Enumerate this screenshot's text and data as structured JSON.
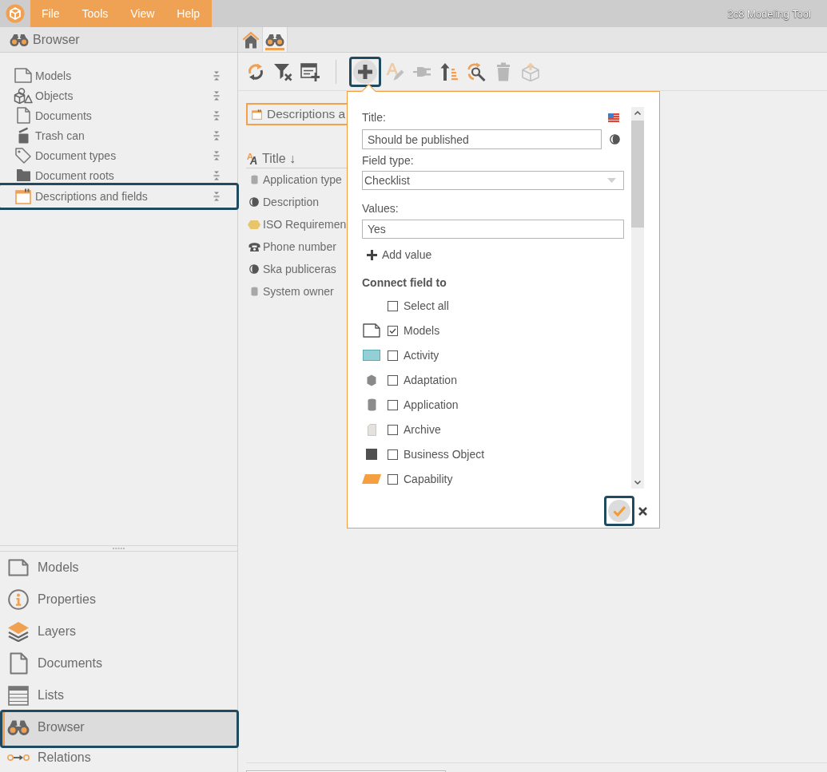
{
  "menu_bar": {
    "items": [
      {
        "label": "File"
      },
      {
        "label": "Tools"
      },
      {
        "label": "View"
      },
      {
        "label": "Help"
      }
    ],
    "app_title": "2c8 Modeling Tool"
  },
  "browser_panel": {
    "title": "Browser",
    "items": [
      {
        "label": "Models",
        "kind": "page",
        "highlighted": false
      },
      {
        "label": "Objects",
        "kind": "shapes",
        "highlighted": false
      },
      {
        "label": "Documents",
        "kind": "document",
        "highlighted": false
      },
      {
        "label": "Trash can",
        "kind": "trash",
        "highlighted": false
      },
      {
        "label": "Document types",
        "kind": "tag",
        "highlighted": false
      },
      {
        "label": "Document roots",
        "kind": "folder",
        "highlighted": false
      },
      {
        "label": "Descriptions and fields",
        "kind": "window",
        "highlighted": true
      }
    ]
  },
  "side_nav": {
    "items": [
      {
        "label": "Models",
        "kind": "page",
        "selected": false,
        "highlighted": false
      },
      {
        "label": "Properties",
        "kind": "info",
        "selected": false,
        "highlighted": false
      },
      {
        "label": "Layers",
        "kind": "layers",
        "selected": false,
        "highlighted": false
      },
      {
        "label": "Documents",
        "kind": "document",
        "selected": false,
        "highlighted": false
      },
      {
        "label": "Lists",
        "kind": "list",
        "selected": false,
        "highlighted": false
      },
      {
        "label": "Browser",
        "kind": "binoculars",
        "selected": true,
        "highlighted": true
      },
      {
        "label": "Relations",
        "kind": "relations",
        "selected": false,
        "highlighted": false
      }
    ]
  },
  "tabs": [
    {
      "kind": "home",
      "selected": false
    },
    {
      "kind": "binoculars",
      "selected": true
    }
  ],
  "toolbar": {
    "groups": [
      [
        {
          "kind": "refresh",
          "disabled": false,
          "highlighted": false
        },
        {
          "kind": "filter",
          "disabled": false,
          "highlighted": false
        },
        {
          "kind": "table",
          "disabled": false,
          "highlighted": false
        }
      ],
      [
        {
          "kind": "add",
          "disabled": false,
          "highlighted": true
        },
        {
          "kind": "font",
          "disabled": true,
          "highlighted": false
        },
        {
          "kind": "plug",
          "disabled": true,
          "highlighted": false
        },
        {
          "kind": "sort",
          "disabled": false,
          "highlighted": false
        },
        {
          "kind": "replace",
          "disabled": false,
          "highlighted": false
        },
        {
          "kind": "bin",
          "disabled": true,
          "highlighted": false
        },
        {
          "kind": "box",
          "disabled": true,
          "highlighted": false
        }
      ]
    ]
  },
  "content": {
    "chip": "Descriptions a",
    "list": {
      "header": "Title",
      "sort_arrow": "↓",
      "rows": [
        {
          "label": "Application type",
          "kind": "cylinder"
        },
        {
          "label": "Description",
          "kind": "moon"
        },
        {
          "label": "ISO Requiremen",
          "kind": "hexagon"
        },
        {
          "label": "Phone number",
          "kind": "phone"
        },
        {
          "label": "Ska publiceras",
          "kind": "moon"
        },
        {
          "label": "System owner",
          "kind": "cylinder"
        }
      ]
    }
  },
  "dialog": {
    "title_label": "Title:",
    "title_value": "Should be published",
    "field_type_label": "Field type:",
    "field_type_value": "Checklist",
    "values_label": "Values:",
    "values": [
      "Yes"
    ],
    "add_value": "Add value",
    "connect_heading": "Connect field to",
    "select_all": {
      "label": "Select all",
      "checked": false
    },
    "object_types": [
      {
        "label": "Models",
        "kind": "page",
        "checked": true
      },
      {
        "label": "Activity",
        "kind": "rectangle",
        "checked": false
      },
      {
        "label": "Adaptation",
        "kind": "hexagon",
        "checked": false
      },
      {
        "label": "Application",
        "kind": "cylinder",
        "checked": false
      },
      {
        "label": "Archive",
        "kind": "sheet",
        "checked": false
      },
      {
        "label": "Business Object",
        "kind": "square",
        "checked": false
      },
      {
        "label": "Capability",
        "kind": "parallelogram",
        "checked": false
      }
    ],
    "confirm": {
      "highlighted": true
    }
  }
}
